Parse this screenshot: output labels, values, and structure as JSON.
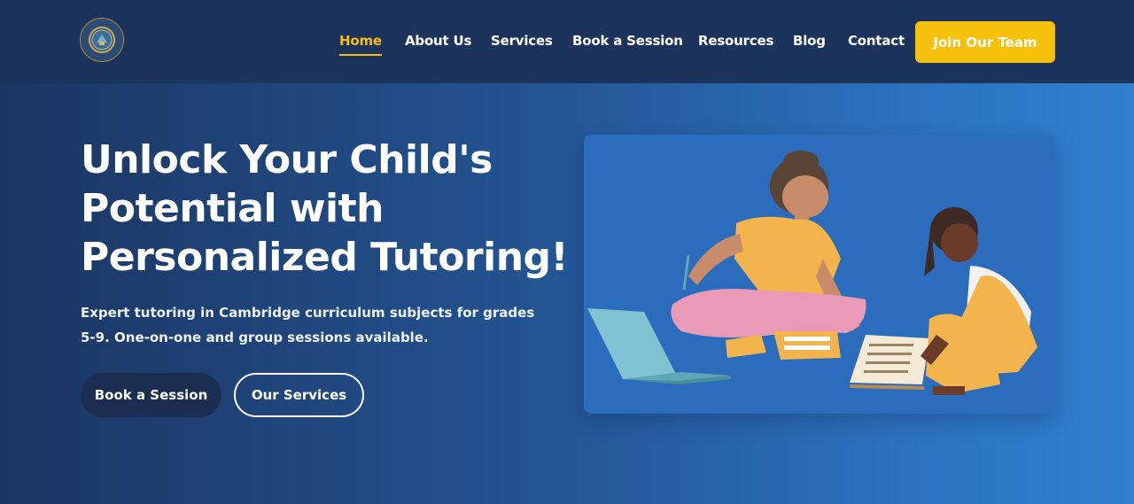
{
  "nav": {
    "logo_icon": "school-crest-icon",
    "links": [
      {
        "label": "Home",
        "active": true
      },
      {
        "label": "About Us",
        "active": false
      },
      {
        "label": "Services",
        "active": false
      },
      {
        "label": "Book a Session",
        "active": false
      },
      {
        "label": "Resources",
        "active": false
      },
      {
        "label": "Blog",
        "active": false
      },
      {
        "label": "Contact",
        "active": false
      }
    ],
    "cta_label": "Join Our Team"
  },
  "hero": {
    "title_lines": [
      "Unlock Your Child's",
      "Potential with",
      "Personalized Tutoring!"
    ],
    "subtitle_lines": [
      "Expert tutoring in Cambridge curriculum subjects for grades",
      "5-9. One-on-one and group sessions available."
    ],
    "primary_button": "Book a Session",
    "secondary_button": "Our Services",
    "illustration": "tutor-and-student-illustration"
  },
  "colors": {
    "navbar_bg": "#1c345b",
    "accent_yellow": "#f6c10c",
    "active_link": "#f5be10",
    "primary_button_bg": "#1b2d50",
    "hero_gradient_start": "#1b3562",
    "hero_gradient_end": "#3080cf"
  }
}
